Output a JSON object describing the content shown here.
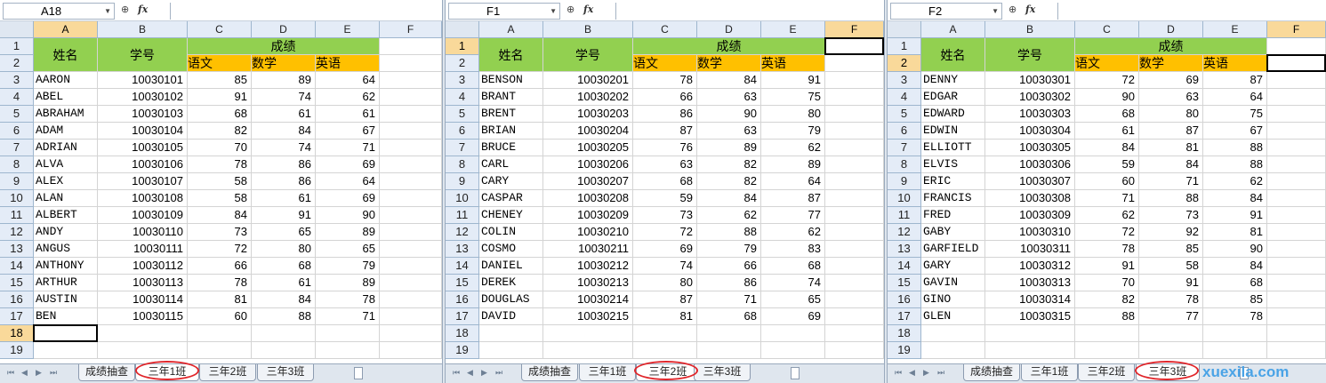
{
  "watermark": "xuexila.com",
  "columns": [
    "A",
    "B",
    "C",
    "D",
    "E",
    "F"
  ],
  "header": {
    "name": "姓名",
    "id": "学号",
    "score": "成绩",
    "chinese": "语文",
    "math": "数学",
    "english": "英语"
  },
  "sheet_tabs": [
    "成绩抽查",
    "三年1班",
    "三年2班",
    "三年3班"
  ],
  "panes": [
    {
      "name_box": "A18",
      "active_tab": 1,
      "rows": [
        [
          "AARON",
          "10030101",
          "85",
          "89",
          "64"
        ],
        [
          "ABEL",
          "10030102",
          "91",
          "74",
          "62"
        ],
        [
          "ABRAHAM",
          "10030103",
          "68",
          "61",
          "61"
        ],
        [
          "ADAM",
          "10030104",
          "82",
          "84",
          "67"
        ],
        [
          "ADRIAN",
          "10030105",
          "70",
          "74",
          "71"
        ],
        [
          "ALVA",
          "10030106",
          "78",
          "86",
          "69"
        ],
        [
          "ALEX",
          "10030107",
          "58",
          "86",
          "64"
        ],
        [
          "ALAN",
          "10030108",
          "58",
          "61",
          "69"
        ],
        [
          "ALBERT",
          "10030109",
          "84",
          "91",
          "90"
        ],
        [
          "ANDY",
          "10030110",
          "73",
          "65",
          "89"
        ],
        [
          "ANGUS",
          "10030111",
          "72",
          "80",
          "65"
        ],
        [
          "ANTHONY",
          "10030112",
          "66",
          "68",
          "79"
        ],
        [
          "ARTHUR",
          "10030113",
          "78",
          "61",
          "89"
        ],
        [
          "AUSTIN",
          "10030114",
          "81",
          "84",
          "78"
        ],
        [
          "BEN",
          "10030115",
          "60",
          "88",
          "71"
        ]
      ]
    },
    {
      "name_box": "F1",
      "active_tab": 2,
      "rows": [
        [
          "BENSON",
          "10030201",
          "78",
          "84",
          "91"
        ],
        [
          "BRANT",
          "10030202",
          "66",
          "63",
          "75"
        ],
        [
          "BRENT",
          "10030203",
          "86",
          "90",
          "80"
        ],
        [
          "BRIAN",
          "10030204",
          "87",
          "63",
          "79"
        ],
        [
          "BRUCE",
          "10030205",
          "76",
          "89",
          "62"
        ],
        [
          "CARL",
          "10030206",
          "63",
          "82",
          "89"
        ],
        [
          "CARY",
          "10030207",
          "68",
          "82",
          "64"
        ],
        [
          "CASPAR",
          "10030208",
          "59",
          "84",
          "87"
        ],
        [
          "CHENEY",
          "10030209",
          "73",
          "62",
          "77"
        ],
        [
          "COLIN",
          "10030210",
          "72",
          "88",
          "62"
        ],
        [
          "COSMO",
          "10030211",
          "69",
          "79",
          "83"
        ],
        [
          "DANIEL",
          "10030212",
          "74",
          "66",
          "68"
        ],
        [
          "DEREK",
          "10030213",
          "80",
          "86",
          "74"
        ],
        [
          "DOUGLAS",
          "10030214",
          "87",
          "71",
          "65"
        ],
        [
          "DAVID",
          "10030215",
          "81",
          "68",
          "69"
        ]
      ]
    },
    {
      "name_box": "F2",
      "active_tab": 3,
      "rows": [
        [
          "DENNY",
          "10030301",
          "72",
          "69",
          "87"
        ],
        [
          "EDGAR",
          "10030302",
          "90",
          "63",
          "64"
        ],
        [
          "EDWARD",
          "10030303",
          "68",
          "80",
          "75"
        ],
        [
          "EDWIN",
          "10030304",
          "61",
          "87",
          "67"
        ],
        [
          "ELLIOTT",
          "10030305",
          "84",
          "81",
          "88"
        ],
        [
          "ELVIS",
          "10030306",
          "59",
          "84",
          "88"
        ],
        [
          "ERIC",
          "10030307",
          "60",
          "71",
          "62"
        ],
        [
          "FRANCIS",
          "10030308",
          "71",
          "88",
          "84"
        ],
        [
          "FRED",
          "10030309",
          "62",
          "73",
          "91"
        ],
        [
          "GABY",
          "10030310",
          "72",
          "92",
          "81"
        ],
        [
          "GARFIELD",
          "10030311",
          "78",
          "85",
          "90"
        ],
        [
          "GARY",
          "10030312",
          "91",
          "58",
          "84"
        ],
        [
          "GAVIN",
          "10030313",
          "70",
          "91",
          "68"
        ],
        [
          "GINO",
          "10030314",
          "82",
          "78",
          "85"
        ],
        [
          "GLEN",
          "10030315",
          "88",
          "77",
          "78"
        ]
      ]
    }
  ]
}
